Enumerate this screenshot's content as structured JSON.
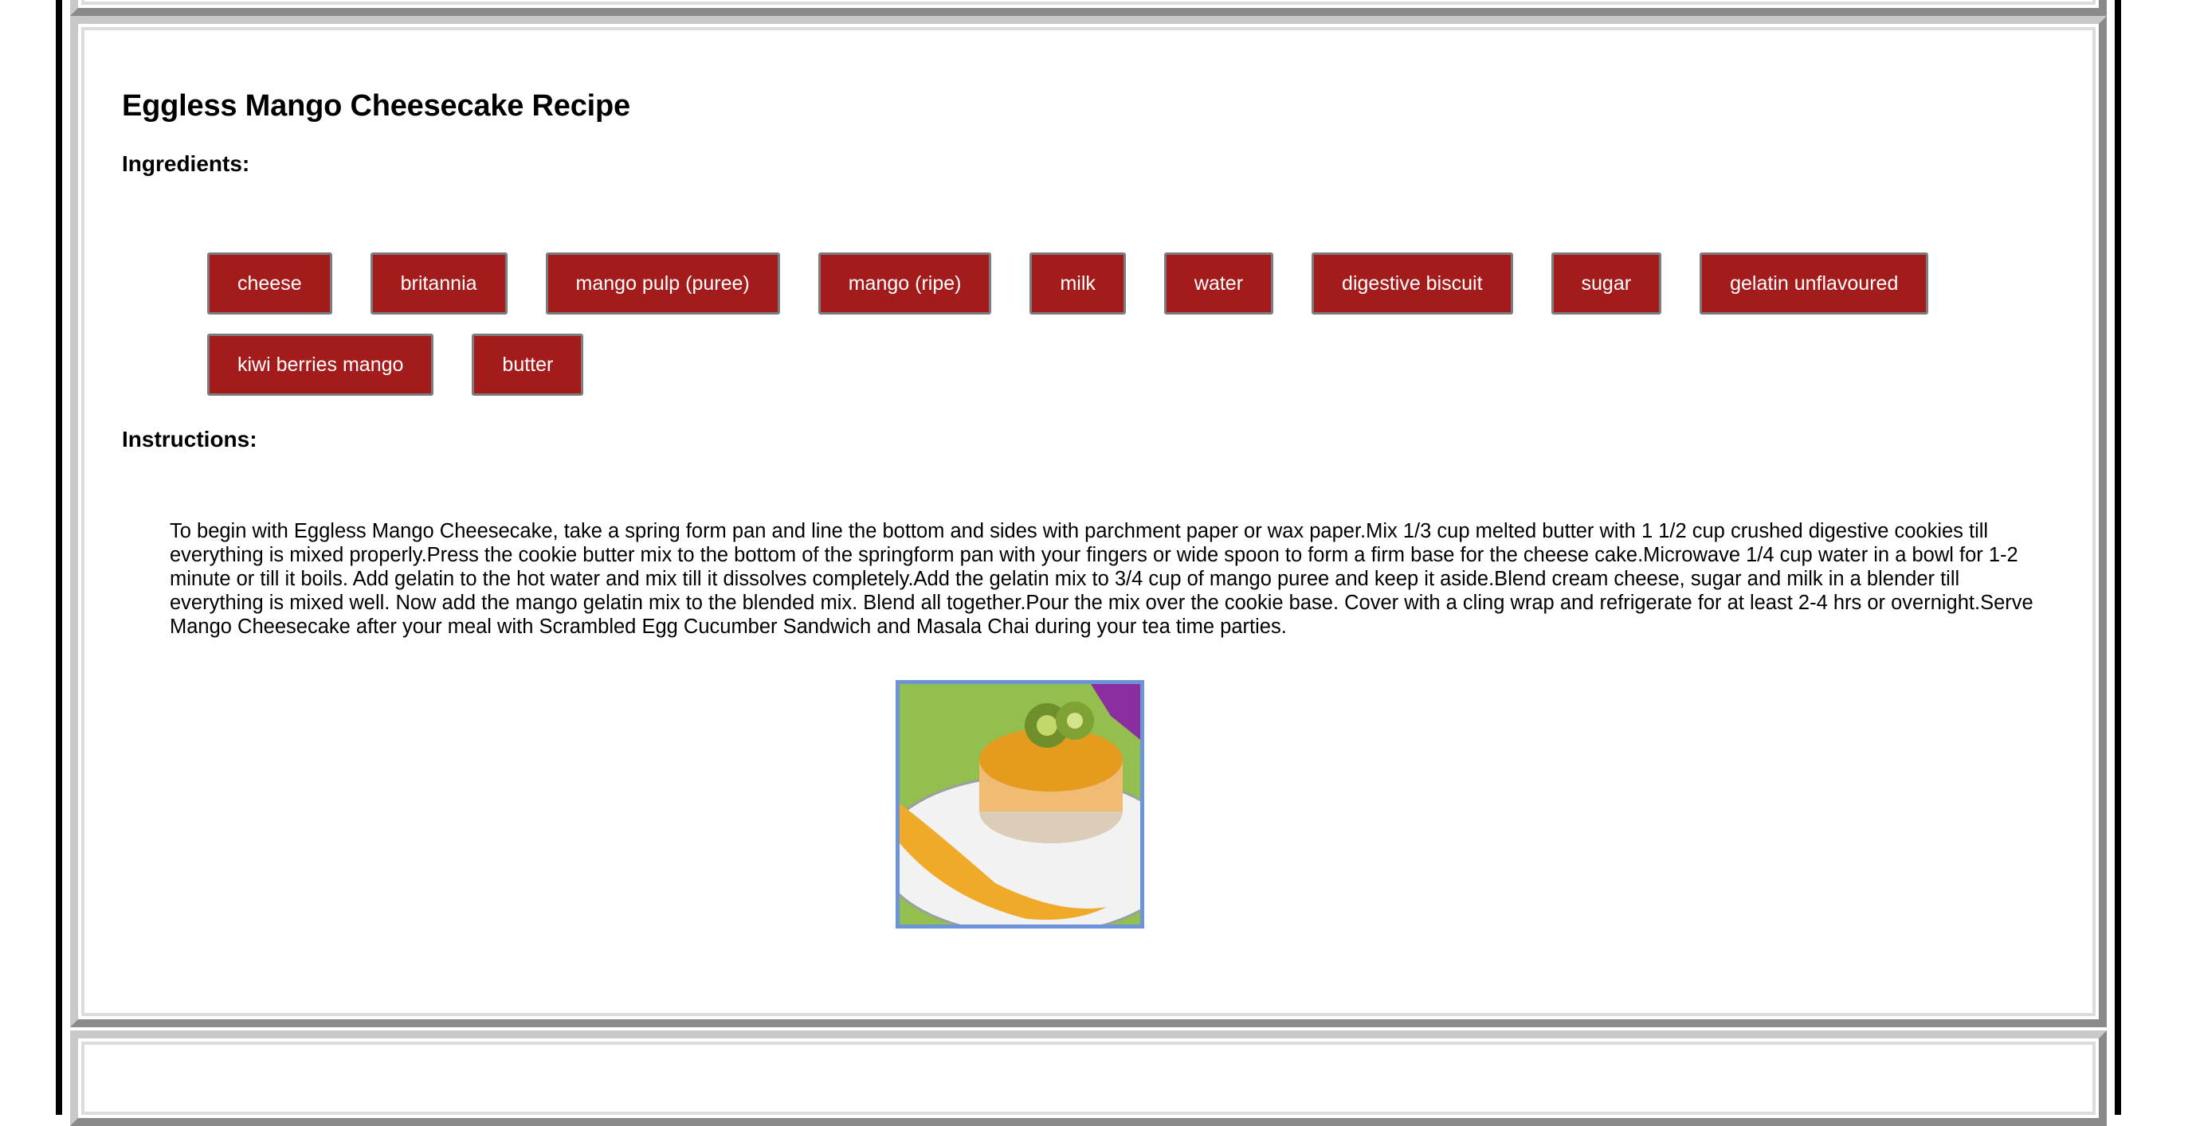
{
  "recipe": {
    "title": "Eggless Mango Cheesecake Recipe",
    "ingredients_heading": "Ingredients:",
    "instructions_heading": "Instructions:",
    "ingredients": [
      "cheese",
      "britannia",
      "mango pulp (puree)",
      "mango (ripe)",
      "milk",
      "water",
      "digestive biscuit",
      "sugar",
      "gelatin unflavoured",
      "kiwi berries mango",
      "butter"
    ],
    "instructions": "To begin with Eggless Mango Cheesecake, take a spring form pan and line the bottom and sides with parchment paper or wax paper.Mix 1/3 cup melted butter with 1 1/2 cup crushed digestive cookies till everything is mixed properly.Press the cookie butter mix to the bottom of the springform pan with your fingers or wide spoon to form a firm base for the cheese cake.Microwave 1/4 cup water in a bowl for 1-2 minute or till it boils. Add gelatin to the hot water and mix till it dissolves completely.Add the gelatin mix to 3/4 cup of mango puree and keep it aside.Blend cream cheese, sugar and milk in a blender till everything is mixed well. Now add the mango gelatin mix to the blended mix. Blend all together.Pour the mix over the cookie base. Cover with a cling wrap and refrigerate for at least 2-4 hrs or overnight.Serve Mango Cheesecake after your meal with Scrambled Egg Cucumber Sandwich and Masala Chai during your tea time parties."
  },
  "colors": {
    "chip_background": "#a31b1b",
    "image_border": "#6d93d8"
  }
}
